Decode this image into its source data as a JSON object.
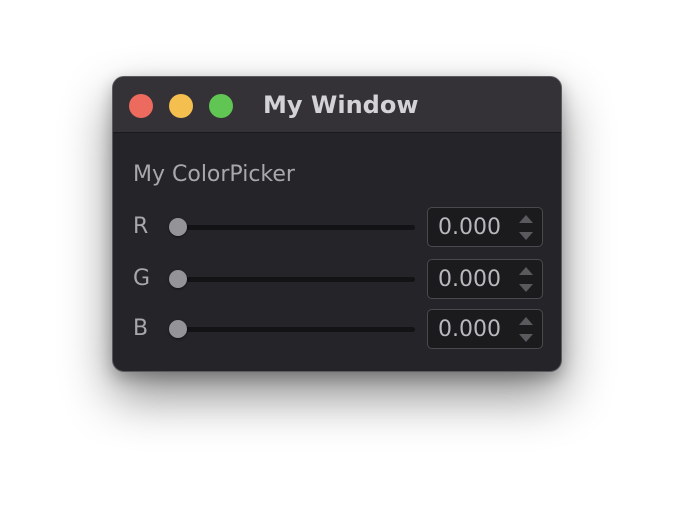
{
  "window": {
    "title": "My Window"
  },
  "color_picker": {
    "label": "My ColorPicker",
    "channels": [
      {
        "label": "R",
        "slider_level": 0,
        "value": "0.000"
      },
      {
        "label": "G",
        "slider_level": 0,
        "value": "0.000"
      },
      {
        "label": "B",
        "slider_level": 0,
        "value": "0.000"
      }
    ]
  },
  "colors": {
    "close": "#ec6a5e",
    "minimize": "#f4bf4f",
    "maximize": "#61c554",
    "window_bg": "#252429",
    "titlebar_bg": "#343236"
  },
  "icons": {
    "spin_up": "triangle-up-icon",
    "spin_down": "triangle-down-icon"
  }
}
